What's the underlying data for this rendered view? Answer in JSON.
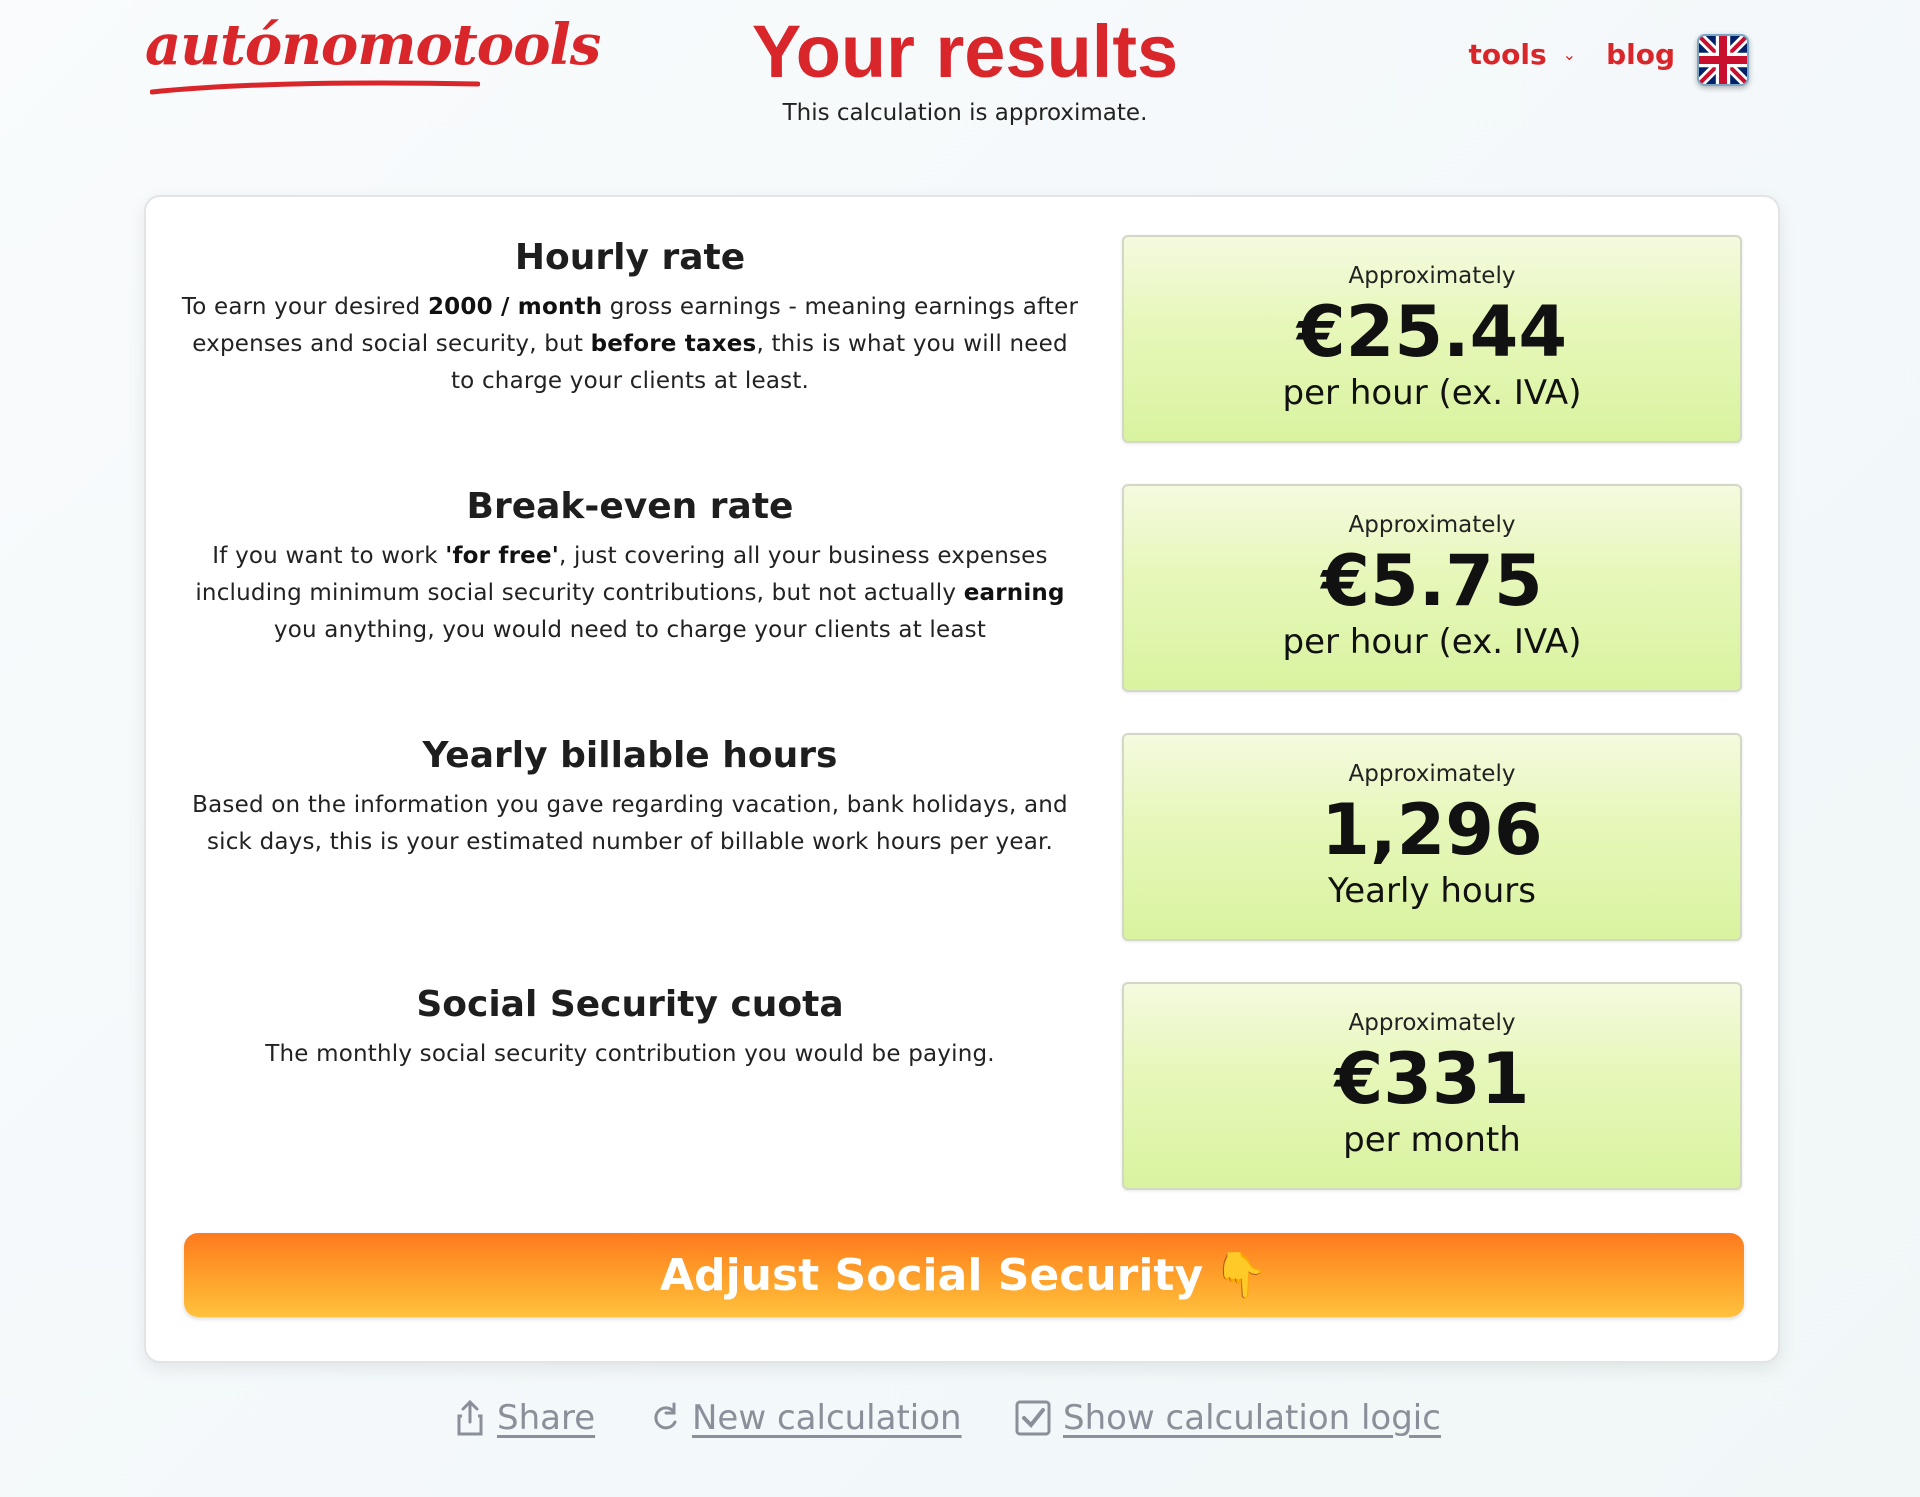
{
  "header": {
    "logo_text": "autónomotools",
    "title": "Your results",
    "subtitle": "This calculation is approximate.",
    "nav": {
      "tools_label": "tools",
      "blog_label": "blog"
    },
    "language_flag": "uk-flag-icon"
  },
  "results": [
    {
      "title": "Hourly rate",
      "desc_parts": [
        "To earn your desired ",
        "2000 / month",
        " gross earnings - meaning earnings after expenses and social security, but ",
        "before taxes",
        ", this is what you will need to charge your clients at least."
      ],
      "approx": "Approximately",
      "value": "€25.44",
      "unit": "per hour (ex. IVA)"
    },
    {
      "title": "Break-even rate",
      "desc_parts": [
        "If you want to work ",
        "'for free'",
        ", just covering all your business expenses including minimum social security contributions, but not actually ",
        "earning",
        " you anything, you would need to charge your clients at least"
      ],
      "approx": "Approximately",
      "value": "€5.75",
      "unit": "per hour (ex. IVA)"
    },
    {
      "title": "Yearly billable hours",
      "desc": "Based on the information you gave regarding vacation, bank holidays, and sick days, this is your estimated number of billable work hours per year.",
      "approx": "Approximately",
      "value": "1,296",
      "unit": "Yearly hours"
    },
    {
      "title": "Social Security cuota",
      "desc": "The monthly social security contribution you would be paying.",
      "approx": "Approximately",
      "value": "€331",
      "unit": "per month"
    }
  ],
  "cta": {
    "label": "Adjust Social Security",
    "emoji": "👇"
  },
  "footer": {
    "share_label": "Share",
    "new_calc_label": "New calculation",
    "logic_label": "Show calculation logic"
  },
  "colors": {
    "brand_red": "#d9262b",
    "result_green": "#e6f7b8",
    "cta_orange": "#fd7a1e"
  }
}
